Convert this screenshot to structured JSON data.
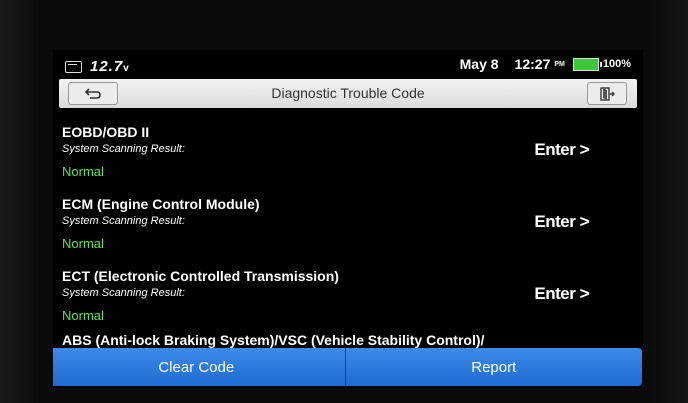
{
  "status": {
    "voltage": "12.7",
    "voltage_unit": "v",
    "date": "May 8",
    "time": "12:27",
    "ampm": "PM",
    "battery": "100%",
    "battery_color": "#3ec73e"
  },
  "header": {
    "title": "Diagnostic Trouble Code"
  },
  "systems": [
    {
      "name": "EOBD/OBD II",
      "sub": "System Scanning Result:",
      "status": "Normal",
      "action": "Enter >"
    },
    {
      "name": "ECM (Engine Control Module)",
      "sub": "System Scanning Result:",
      "status": "Normal",
      "action": "Enter >"
    },
    {
      "name": "ECT (Electronic Controlled Transmission)",
      "sub": "System Scanning Result:",
      "status": "Normal",
      "action": "Enter >"
    },
    {
      "name": "ABS (Anti-lock Braking System)/VSC (Vehicle Stability Control)/"
    }
  ],
  "footer": {
    "clear_label": "Clear Code",
    "report_label": "Report"
  },
  "colors": {
    "normal": "#57e04a",
    "button": "#2f7ddd"
  }
}
